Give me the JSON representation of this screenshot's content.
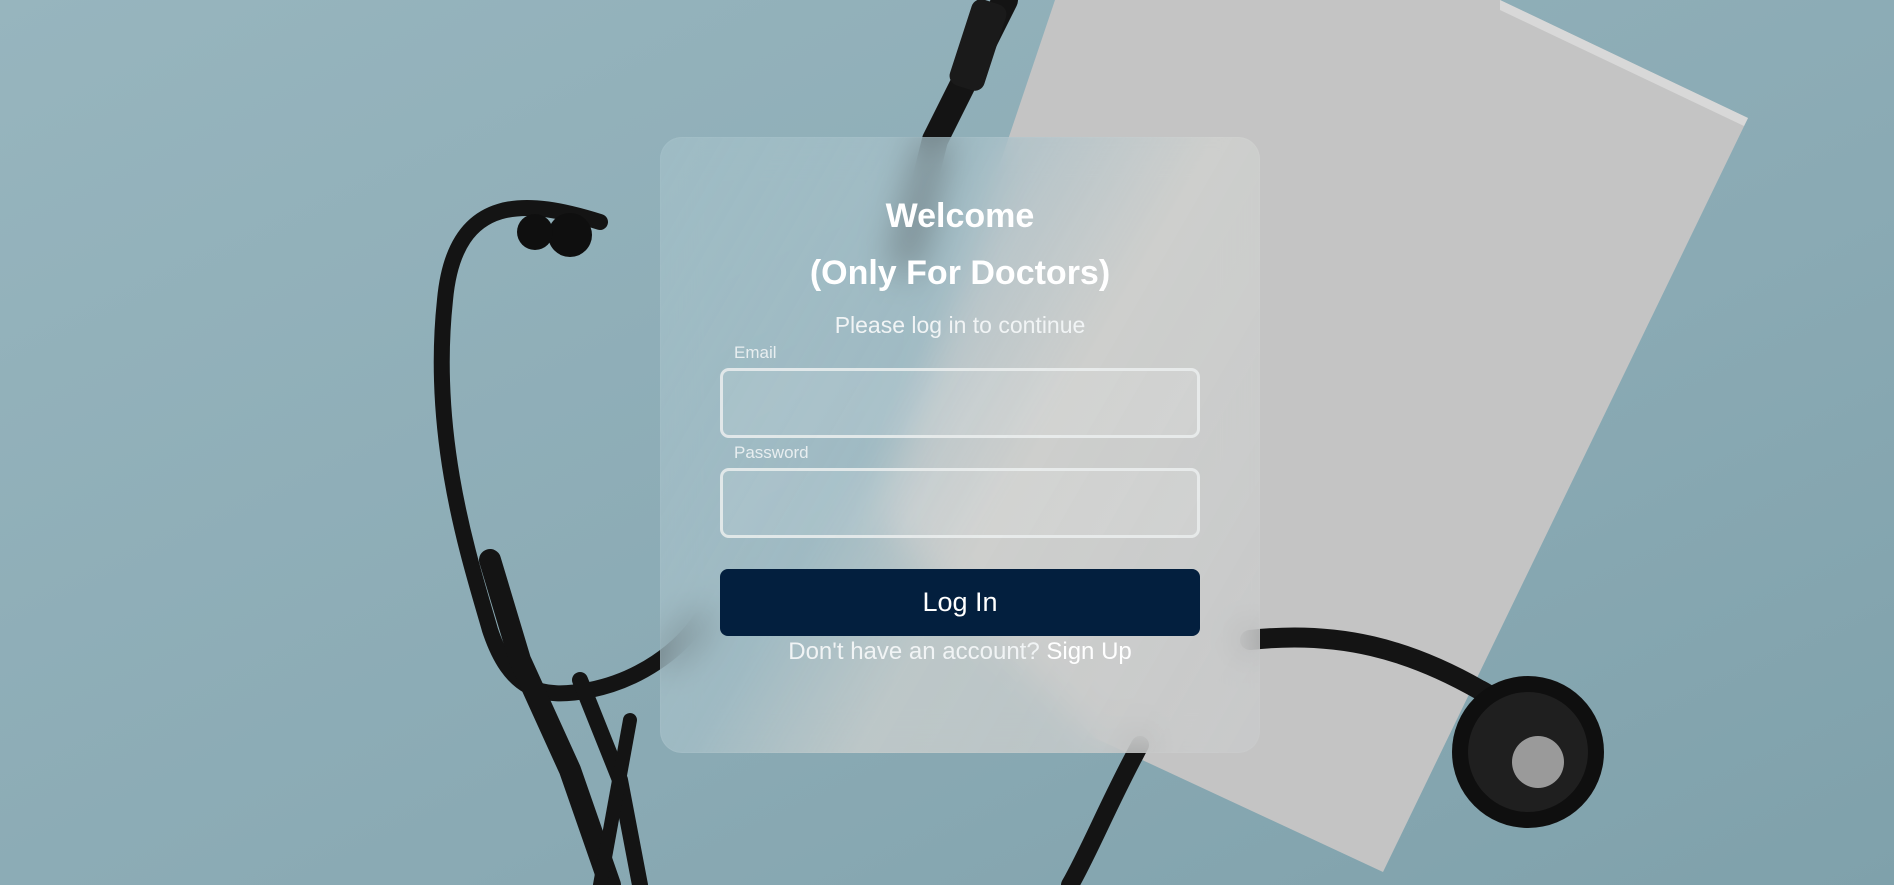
{
  "login": {
    "title_line1": "Welcome",
    "title_line2": "(Only For Doctors)",
    "subtitle": "Please log in to continue",
    "email_label": "Email",
    "email_value": "",
    "password_label": "Password",
    "password_value": "",
    "submit_label": "Log In",
    "signup_prompt": "Don't have an account?",
    "signup_link": "Sign Up"
  },
  "colors": {
    "background": "#8fb0ba",
    "button": "#031f3e",
    "text": "#ffffff"
  },
  "icons": {
    "background": "stethoscope-on-paper-illustration"
  }
}
